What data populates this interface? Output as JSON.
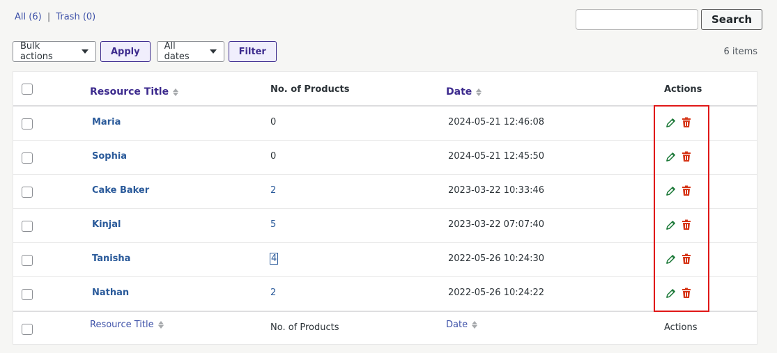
{
  "views": {
    "all": "All (6)",
    "separator": "|",
    "trash": "Trash (0)"
  },
  "search": {
    "value": "",
    "placeholder": "",
    "button_label": "Search"
  },
  "toolbar": {
    "bulk_actions": "Bulk actions",
    "apply_label": "Apply",
    "dates": "All dates",
    "filter_label": "Filter",
    "items_count": "6 items"
  },
  "table": {
    "columns": {
      "title": "Resource Title",
      "products": "No. of Products",
      "date": "Date",
      "actions": "Actions"
    },
    "rows": [
      {
        "title": "Maria",
        "products": "0",
        "date": "2024-05-21 12:46:08"
      },
      {
        "title": "Sophia",
        "products": "0",
        "date": "2024-05-21 12:45:50"
      },
      {
        "title": "Cake Baker",
        "products": "2",
        "date": "2023-03-22 10:33:46"
      },
      {
        "title": "Kinjal",
        "products": "5",
        "date": "2023-03-22 07:07:40"
      },
      {
        "title": "Tanisha",
        "products": "4",
        "date": "2022-05-26 10:24:30"
      },
      {
        "title": "Nathan",
        "products": "2",
        "date": "2022-05-26 10:24:22"
      }
    ],
    "action_icons": {
      "edit": "pencil-icon",
      "delete": "trash-icon"
    }
  },
  "colors": {
    "accent": "#3d2b8e",
    "link": "#2a5a9a",
    "edit_icon": "#1e7a3a",
    "delete_icon": "#d63618",
    "highlight": "#e01818"
  }
}
